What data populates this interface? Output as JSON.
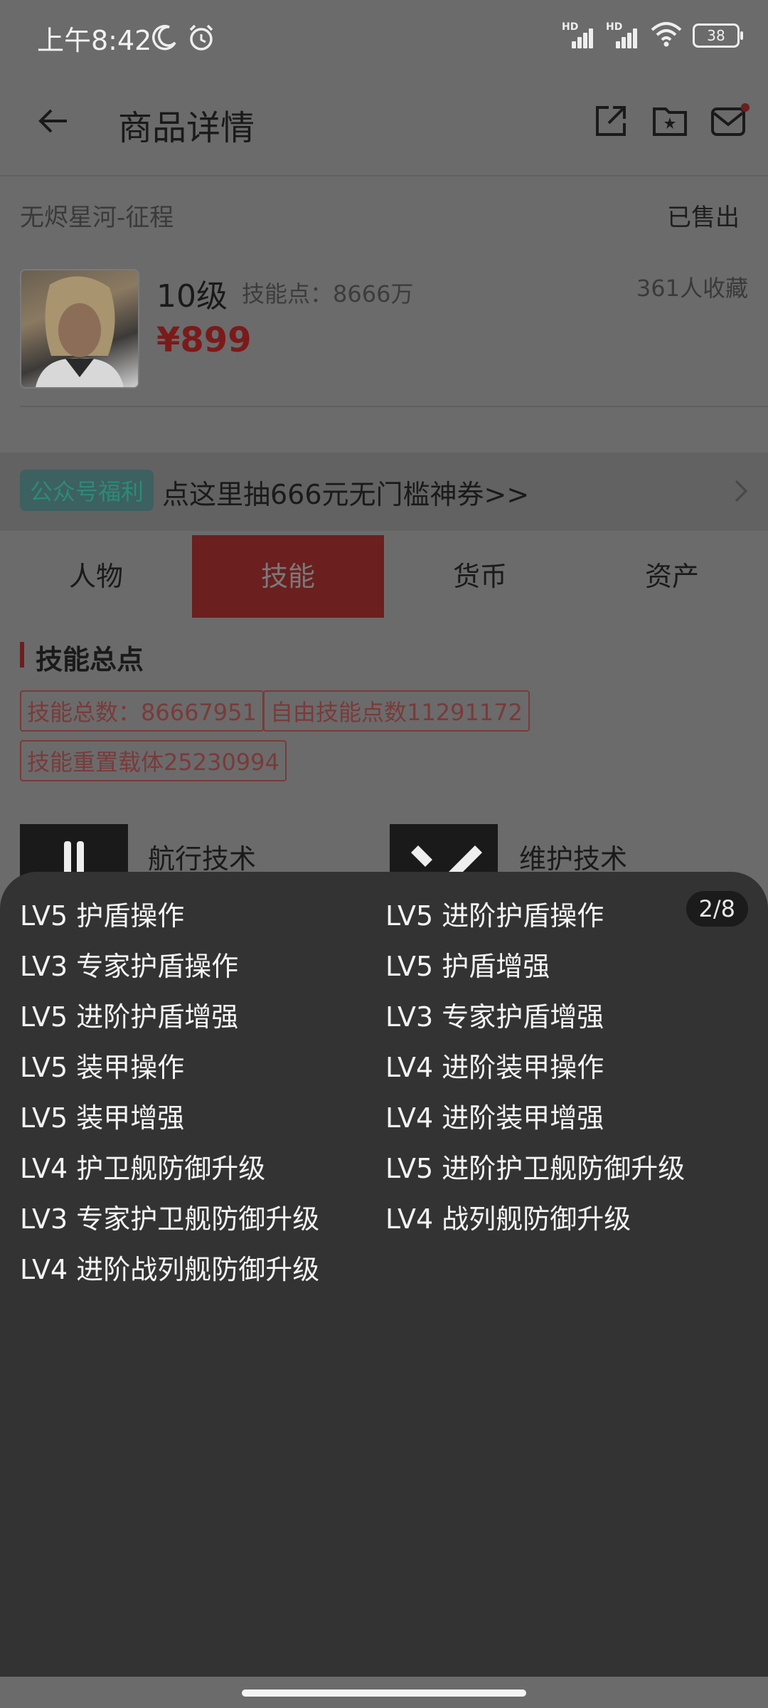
{
  "status": {
    "time": "上午8:42",
    "battery": "38"
  },
  "header": {
    "title": "商品详情"
  },
  "item": {
    "game": "无烬星河-征程",
    "state": "已售出",
    "level": "10级",
    "skill_points": "技能点：8666万",
    "favorites": "361人收藏",
    "price": "¥899"
  },
  "promo": {
    "tag": "公众号福利",
    "text": "点这里抽666元无门槛神券>>"
  },
  "tabs": [
    "人物",
    "技能",
    "货币",
    "资产"
  ],
  "section": {
    "title": "技能总点",
    "chips": [
      "技能总数：86667951",
      "自由技能点数11291172",
      "技能重置载体25230994"
    ]
  },
  "categories": [
    "航行技术",
    "维护技术"
  ],
  "sheet": {
    "pager": "2/8",
    "left": [
      "LV5 护盾操作",
      "LV3 专家护盾操作",
      "LV5 进阶护盾增强",
      "LV5 装甲操作",
      "LV5 装甲增强",
      "LV4 护卫舰防御升级",
      "LV3 专家护卫舰防御升级",
      "LV4 进阶战列舰防御升级"
    ],
    "right": [
      "LV5 进阶护盾操作",
      "LV5 护盾增强",
      "LV3 专家护盾增强",
      "LV4 进阶装甲操作",
      "LV4 进阶装甲增强",
      "LV5 进阶护卫舰防御升级",
      "LV4 战列舰防御升级"
    ]
  },
  "colors": {
    "accent": "#6b1f1f",
    "sheet_bg": "#333333",
    "overlay": "#6b6b6b"
  }
}
